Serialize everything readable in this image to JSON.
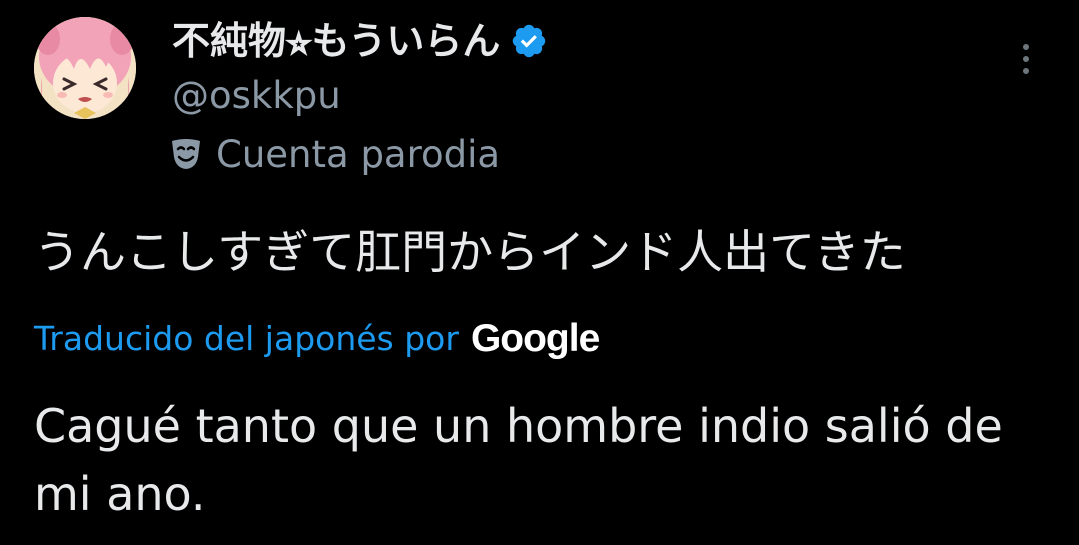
{
  "tweet": {
    "author": {
      "display_name": "不純物⭐︎もういらん",
      "handle": "@oskkpu",
      "verified": true,
      "parody_label": "Cuenta parodia",
      "avatar_icon": "anime-avatar"
    },
    "more_icon": "more-dots-icon",
    "original_text": "うんこしすぎて肛門からインド人出てきた",
    "translation": {
      "link_label": "Traducido del japonés por",
      "provider": "Google",
      "text": "Cagué tanto que un hombre indio salió de mi ano."
    }
  },
  "colors": {
    "background": "#000000",
    "primary_text": "#e7e9ea",
    "secondary_text": "#8b98a5",
    "link": "#1d9bf0",
    "verified": "#1d9bf0"
  }
}
